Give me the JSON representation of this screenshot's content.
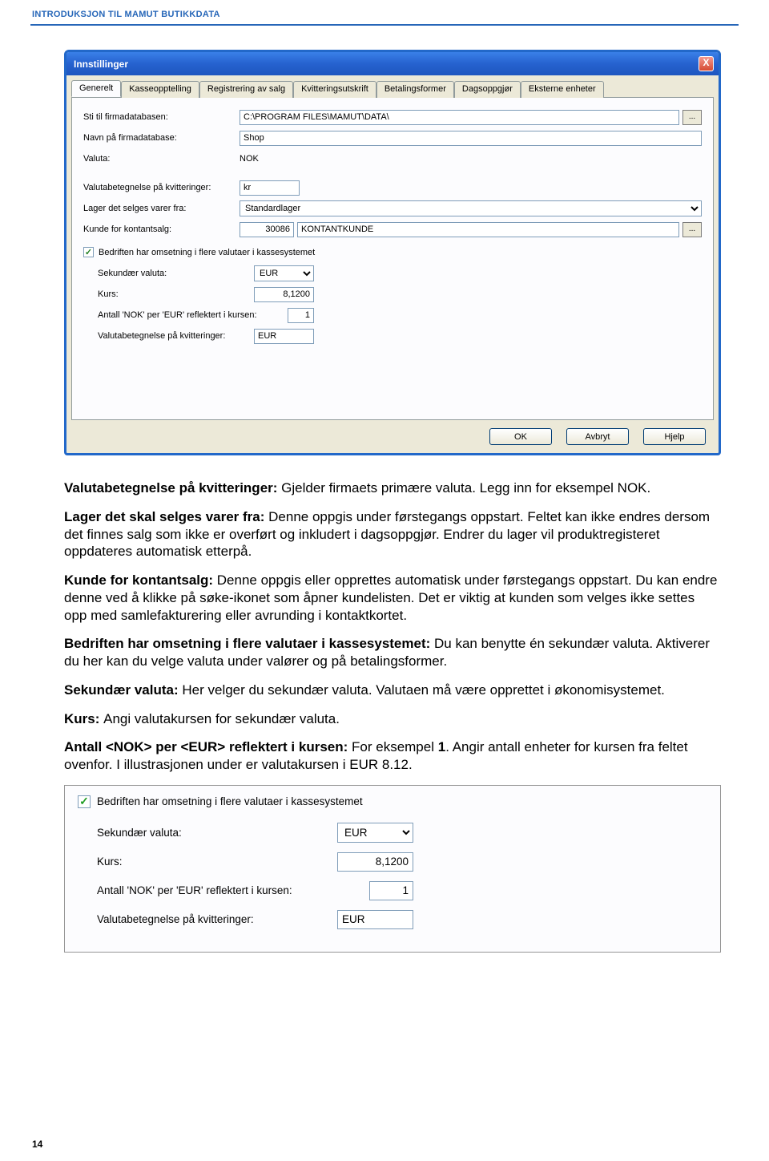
{
  "header": "INTRODUKSJON TIL MAMUT BUTIKKDATA",
  "page_number": "14",
  "dialog": {
    "title": "Innstillinger",
    "close": "X",
    "tabs": [
      "Generelt",
      "Kasseopptelling",
      "Registrering av salg",
      "Kvitteringsutskrift",
      "Betalingsformer",
      "Dagsoppgjør",
      "Eksterne enheter"
    ],
    "active_tab": 0,
    "fields": {
      "path_label": "Sti til firmadatabasen:",
      "path_value": "C:\\PROGRAM FILES\\MAMUT\\DATA\\",
      "dbname_label": "Navn på firmadatabase:",
      "dbname_value": "Shop",
      "currency_label": "Valuta:",
      "currency_value": "NOK",
      "curr_receipt_label": "Valutabetegnelse på kvitteringer:",
      "curr_receipt_value": "kr",
      "store_label": "Lager det selges varer fra:",
      "store_value": "Standardlager",
      "cust_label": "Kunde for kontantsalg:",
      "cust_id": "30086",
      "cust_name": "KONTANTKUNDE",
      "multi_curr_check": "Bedriften har omsetning i flere valutaer i kassesystemet",
      "sec_curr_label": "Sekundær valuta:",
      "sec_curr_value": "EUR",
      "rate_label": "Kurs:",
      "rate_value": "8,1200",
      "per_label": "Antall 'NOK' per 'EUR' reflektert i kursen:",
      "per_value": "1",
      "sec_receipt_label": "Valutabetegnelse på kvitteringer:",
      "sec_receipt_value": "EUR"
    },
    "buttons": {
      "ok": "OK",
      "cancel": "Avbryt",
      "help": "Hjelp"
    }
  },
  "paragraphs": {
    "p1_b": "Valutabetegnelse på kvitteringer: ",
    "p1": "Gjelder firmaets primære valuta. Legg inn for eksempel NOK.",
    "p2_b": "Lager det skal selges varer fra: ",
    "p2": "Denne oppgis under førstegangs oppstart. Feltet kan ikke endres dersom det finnes salg som ikke er overført og inkludert i dagsoppgjør. Endrer du lager vil produktregisteret oppdateres automatisk etterpå.",
    "p3_b": "Kunde for kontantsalg: ",
    "p3": "Denne oppgis eller opprettes automatisk under førstegangs oppstart. Du kan endre denne ved å klikke på søke-ikonet som åpner kundelisten. Det er viktig at kunden som velges ikke settes opp med samlefakturering eller avrunding i kontaktkortet.",
    "p4_b": "Bedriften har omsetning i flere valutaer i kassesystemet: ",
    "p4": "Du kan benytte én sekundær valuta. Aktiverer du her kan du velge valuta under valører og på betalingsformer.",
    "p5_b": "Sekundær valuta: ",
    "p5": "Her velger du sekundær valuta. Valutaen må være opprettet i økonomisystemet.",
    "p6_b": "Kurs: ",
    "p6": "Angi valutakursen for sekundær valuta.",
    "p7_b": "Antall <NOK> per <EUR> reflektert i kursen: ",
    "p7a": "For eksempel ",
    "p7b": "1",
    "p7c": ". Angir antall enheter for kursen fra feltet ovenfor. I illustrasjonen under er valutakursen i EUR 8.12."
  },
  "clip": {
    "check_label": "Bedriften har omsetning i flere valutaer i kassesystemet",
    "sec_label": "Sekundær valuta:",
    "sec_value": "EUR",
    "rate_label": "Kurs:",
    "rate_value": "8,1200",
    "per_label": "Antall 'NOK' per 'EUR' reflektert i kursen:",
    "per_value": "1",
    "rec_label": "Valutabetegnelse på kvitteringer:",
    "rec_value": "EUR"
  }
}
